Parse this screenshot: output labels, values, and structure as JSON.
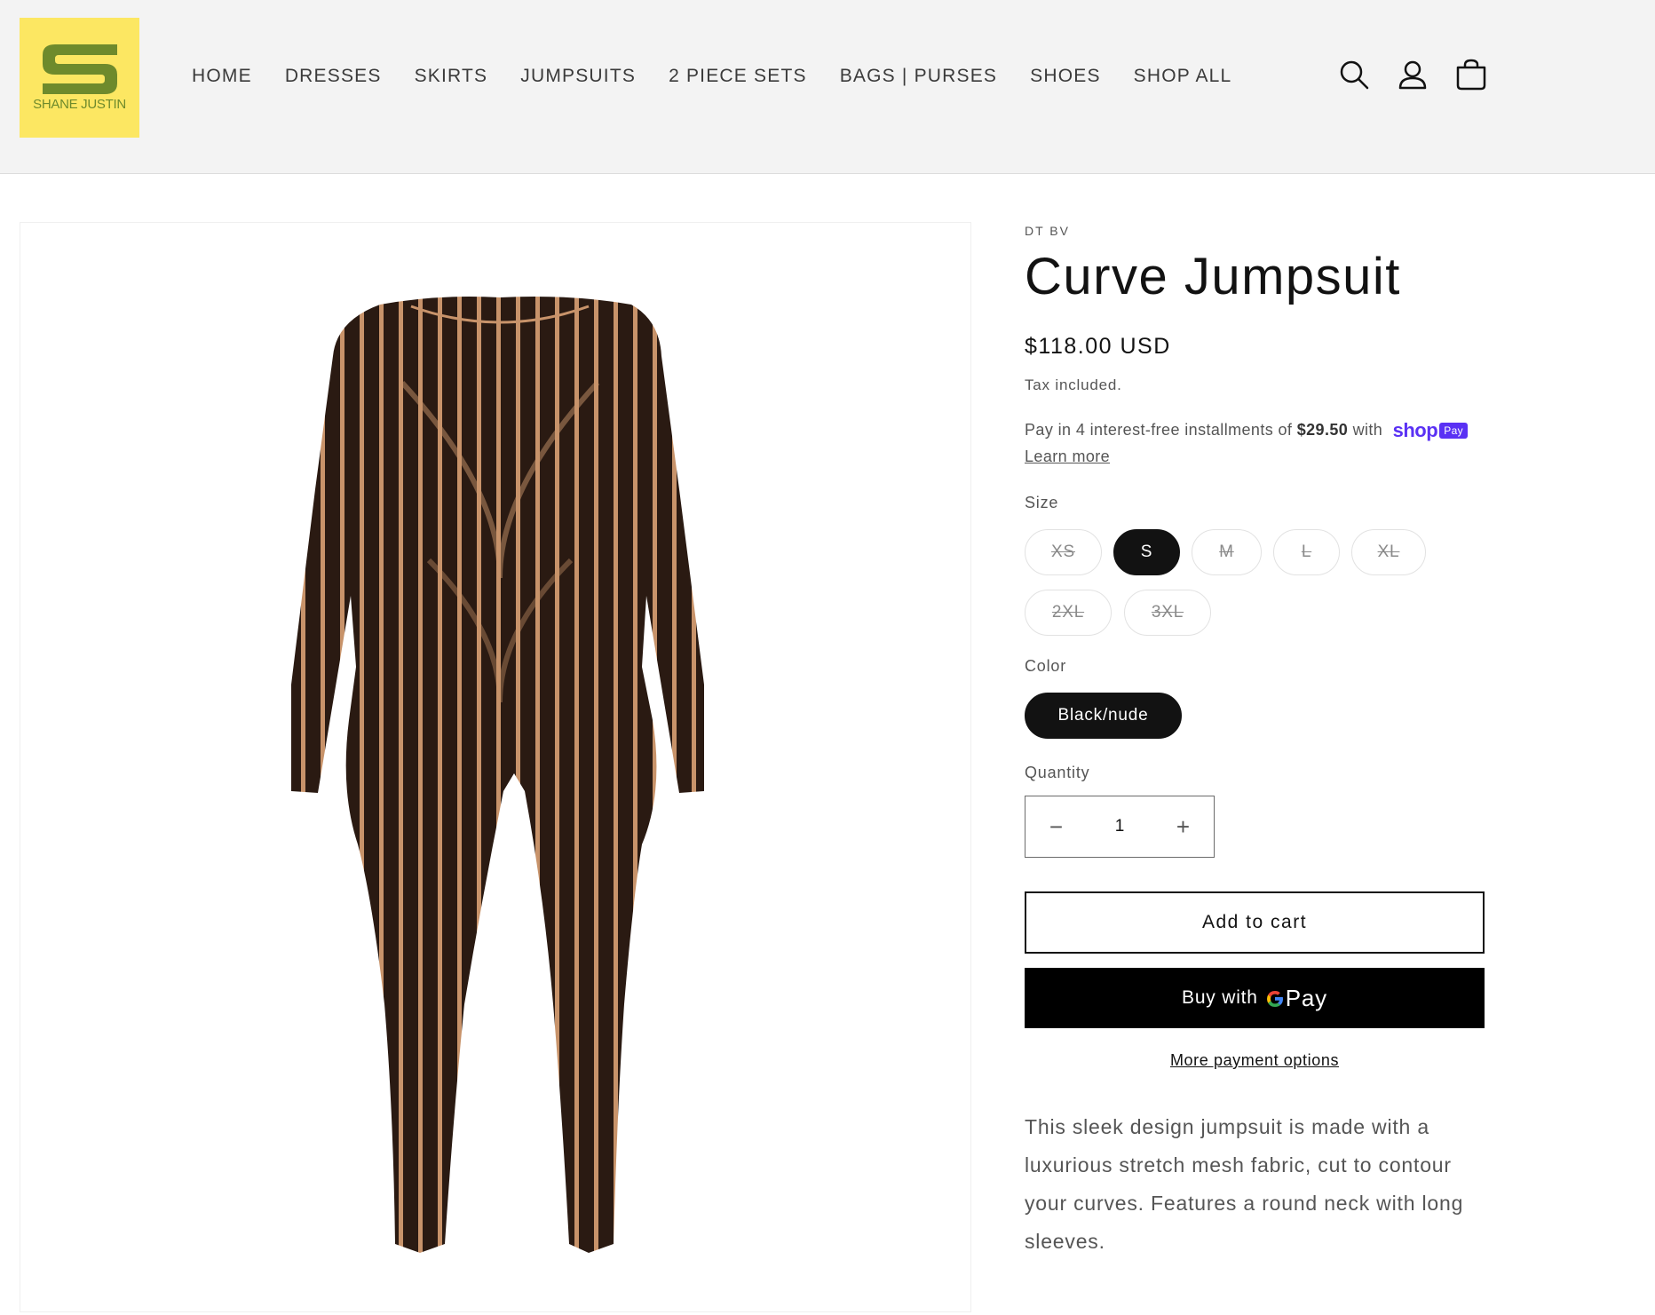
{
  "brand": {
    "name": "SHANE JUSTIN",
    "logo_color": "#fce762",
    "logo_mark_color": "#6e8a2c"
  },
  "nav": {
    "items": [
      "HOME",
      "DRESSES",
      "SKIRTS",
      "JUMPSUITS",
      "2 PIECE SETS",
      "BAGS | PURSES",
      "SHOES",
      "SHOP ALL"
    ]
  },
  "header_icons": {
    "search": "search-icon",
    "account": "account-icon",
    "cart": "cart-icon"
  },
  "product": {
    "vendor": "DT BV",
    "title": "Curve Jumpsuit",
    "price": "$118.00 USD",
    "tax_note": "Tax included.",
    "installments_prefix": "Pay in 4 interest-free installments of ",
    "installments_amount": "$29.50",
    "installments_suffix": " with",
    "shop_pay_word": "shop",
    "shop_pay_badge": "Pay",
    "learn_more": "Learn more",
    "size_label": "Size",
    "sizes": [
      {
        "label": "XS",
        "available": false,
        "selected": false
      },
      {
        "label": "S",
        "available": true,
        "selected": true
      },
      {
        "label": "M",
        "available": false,
        "selected": false
      },
      {
        "label": "L",
        "available": false,
        "selected": false
      },
      {
        "label": "XL",
        "available": false,
        "selected": false
      },
      {
        "label": "2XL",
        "available": false,
        "selected": false
      },
      {
        "label": "3XL",
        "available": false,
        "selected": false
      }
    ],
    "color_label": "Color",
    "color_selected": "Black/nude",
    "quantity_label": "Quantity",
    "quantity": "1",
    "quantity_minus": "−",
    "quantity_plus": "+",
    "add_to_cart": "Add to cart",
    "buy_with": "Buy with",
    "gpay_g": "G",
    "gpay_pay": "Pay",
    "more_payment_options": "More payment options",
    "description": "This sleek design jumpsuit is made with a luxurious stretch mesh fabric, cut to contour your curves. Features a round neck with long sleeves.",
    "image_alt": "jumpsuit-product-image"
  },
  "colors": {
    "accent": "#121212",
    "shop_pay": "#5a31f4",
    "header_bg": "#f3f3f3",
    "fabric_dark": "#2a1a12",
    "fabric_stripe": "#c8936a"
  }
}
